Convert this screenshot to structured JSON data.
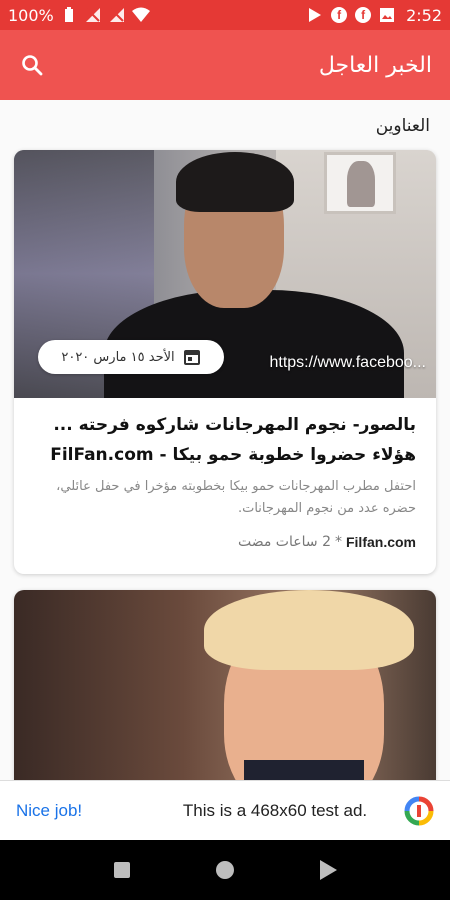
{
  "status_bar": {
    "battery_percent": "100%",
    "time": "2:52",
    "icons": [
      "battery-icon",
      "no-signal-icon",
      "no-signal-icon",
      "wifi-icon",
      "play-store-icon",
      "facebook-icon",
      "facebook-icon",
      "image-icon"
    ]
  },
  "app_bar": {
    "title": "الخبر العاجل",
    "search_icon": "search-icon"
  },
  "section": {
    "title": "العناوين"
  },
  "cards": [
    {
      "date": "الأحد ١٥ مارس ٢٠٢٠",
      "source_url": "https://www.faceboo...",
      "headline": "بالصور- نجوم المهرجانات شاركوه فرحته ... هؤلاء حضروا خطوبة حمو بيكا - FilFan.com",
      "excerpt": "احتفل مطرب المهرجانات حمو بيكا بخطوبته مؤخرا في حفل عائلي، حضره عدد من نجوم المهرجانات.",
      "source": "Filfan.com",
      "separator": "*",
      "time_ago": "2 ساعات مضت"
    }
  ],
  "ad": {
    "label": "Nice job!",
    "text": "This is a 468x60 test ad."
  },
  "colors": {
    "status_bar": "#e53935",
    "app_bar": "#ef5350",
    "ad_accent": "#1a73e8"
  }
}
